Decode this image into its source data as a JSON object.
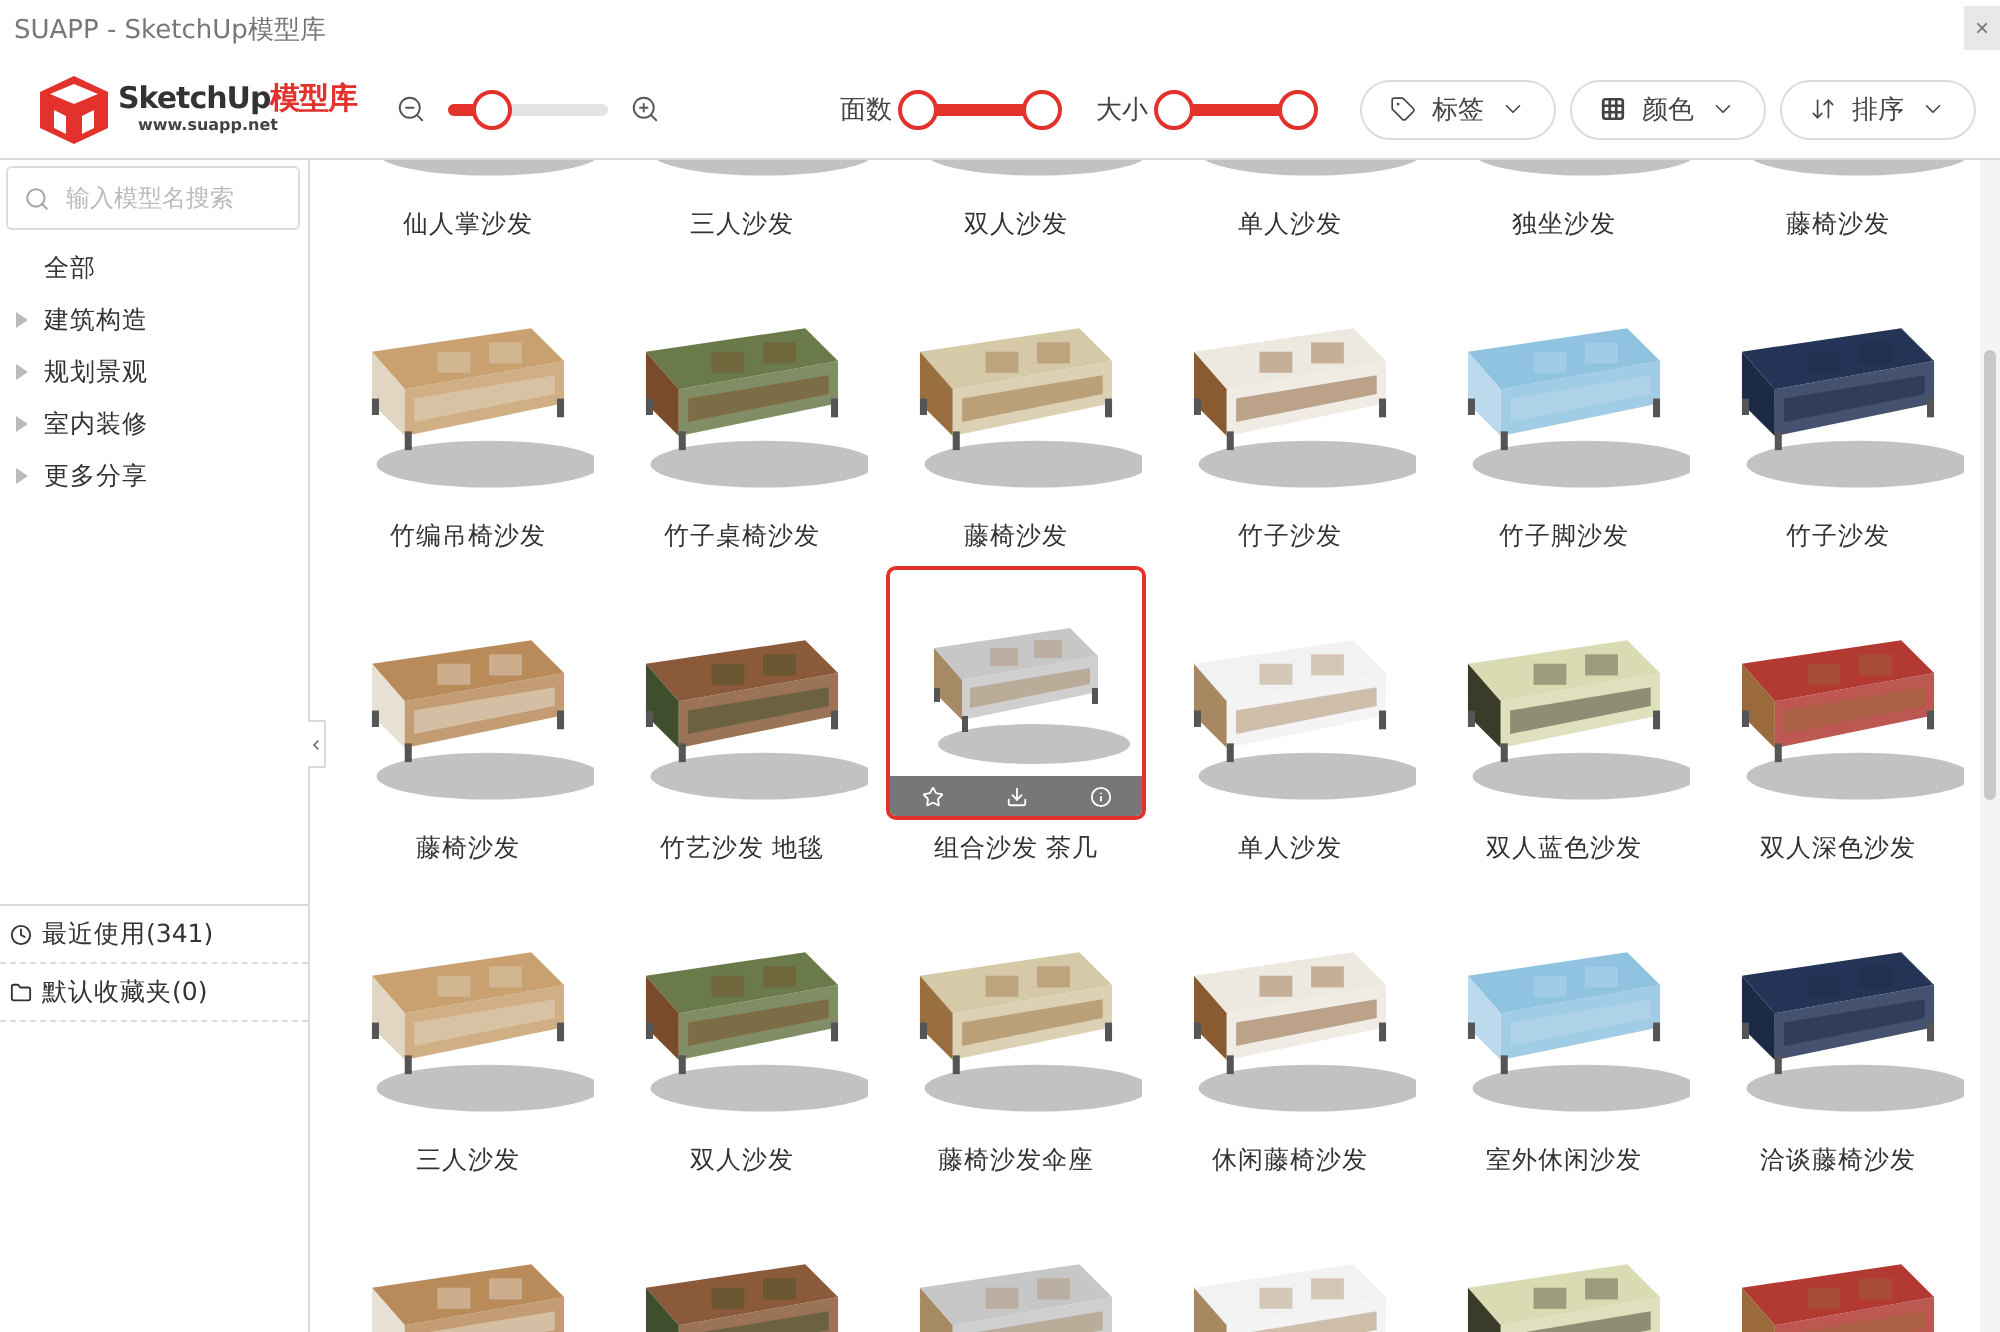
{
  "window": {
    "title": "SUAPP - SketchUp模型库",
    "close": "×"
  },
  "logo": {
    "name": "SketchUp",
    "suffix": "模型库",
    "url": "www.suapp.net"
  },
  "zoom_slider": {
    "level": 0.27
  },
  "range_filters": [
    {
      "label": "面数",
      "thumbs": [
        {
          "level": 0
        },
        {
          "level": 1
        }
      ]
    },
    {
      "label": "大小",
      "thumbs": [
        {
          "level": 0
        },
        {
          "level": 1
        }
      ]
    }
  ],
  "filter_buttons": [
    {
      "kind": "tag",
      "label": "标签"
    },
    {
      "kind": "color",
      "label": "颜色"
    },
    {
      "kind": "sort",
      "label": "排序"
    }
  ],
  "search": {
    "placeholder": "输入模型名搜索"
  },
  "tree": [
    {
      "label": "全部",
      "expandable": false
    },
    {
      "label": "建筑构造",
      "expandable": true
    },
    {
      "label": "规划景观",
      "expandable": true
    },
    {
      "label": "室内装修",
      "expandable": true
    },
    {
      "label": "更多分享",
      "expandable": true
    }
  ],
  "collections": [
    {
      "kind": "recent",
      "label": "最近使用(341)"
    },
    {
      "kind": "folder",
      "label": "默认收藏夹(0)"
    }
  ],
  "models": [
    {
      "label": "仙人掌沙发",
      "selected": false
    },
    {
      "label": "三人沙发",
      "selected": false
    },
    {
      "label": "双人沙发",
      "selected": false
    },
    {
      "label": "单人沙发",
      "selected": false
    },
    {
      "label": "独坐沙发",
      "selected": false
    },
    {
      "label": "藤椅沙发",
      "selected": false
    },
    {
      "label": "竹编吊椅沙发",
      "selected": false
    },
    {
      "label": "竹子桌椅沙发",
      "selected": false
    },
    {
      "label": "藤椅沙发",
      "selected": false
    },
    {
      "label": "竹子沙发",
      "selected": false
    },
    {
      "label": "竹子脚沙发",
      "selected": false
    },
    {
      "label": "竹子沙发",
      "selected": false
    },
    {
      "label": "藤椅沙发",
      "selected": false
    },
    {
      "label": "竹艺沙发 地毯",
      "selected": false
    },
    {
      "label": "组合沙发 茶几",
      "selected": true
    },
    {
      "label": "单人沙发",
      "selected": false
    },
    {
      "label": "双人蓝色沙发",
      "selected": false
    },
    {
      "label": "双人深色沙发",
      "selected": false
    },
    {
      "label": "三人沙发",
      "selected": false
    },
    {
      "label": "双人沙发",
      "selected": false
    },
    {
      "label": "藤椅沙发伞座",
      "selected": false
    },
    {
      "label": "休闲藤椅沙发",
      "selected": false
    },
    {
      "label": "室外休闲沙发",
      "selected": false
    },
    {
      "label": "洽谈藤椅沙发",
      "selected": false
    },
    {
      "selected": false
    },
    {
      "selected": false
    },
    {
      "selected": false
    },
    {
      "selected": false
    },
    {
      "selected": false
    },
    {
      "selected": false
    }
  ]
}
